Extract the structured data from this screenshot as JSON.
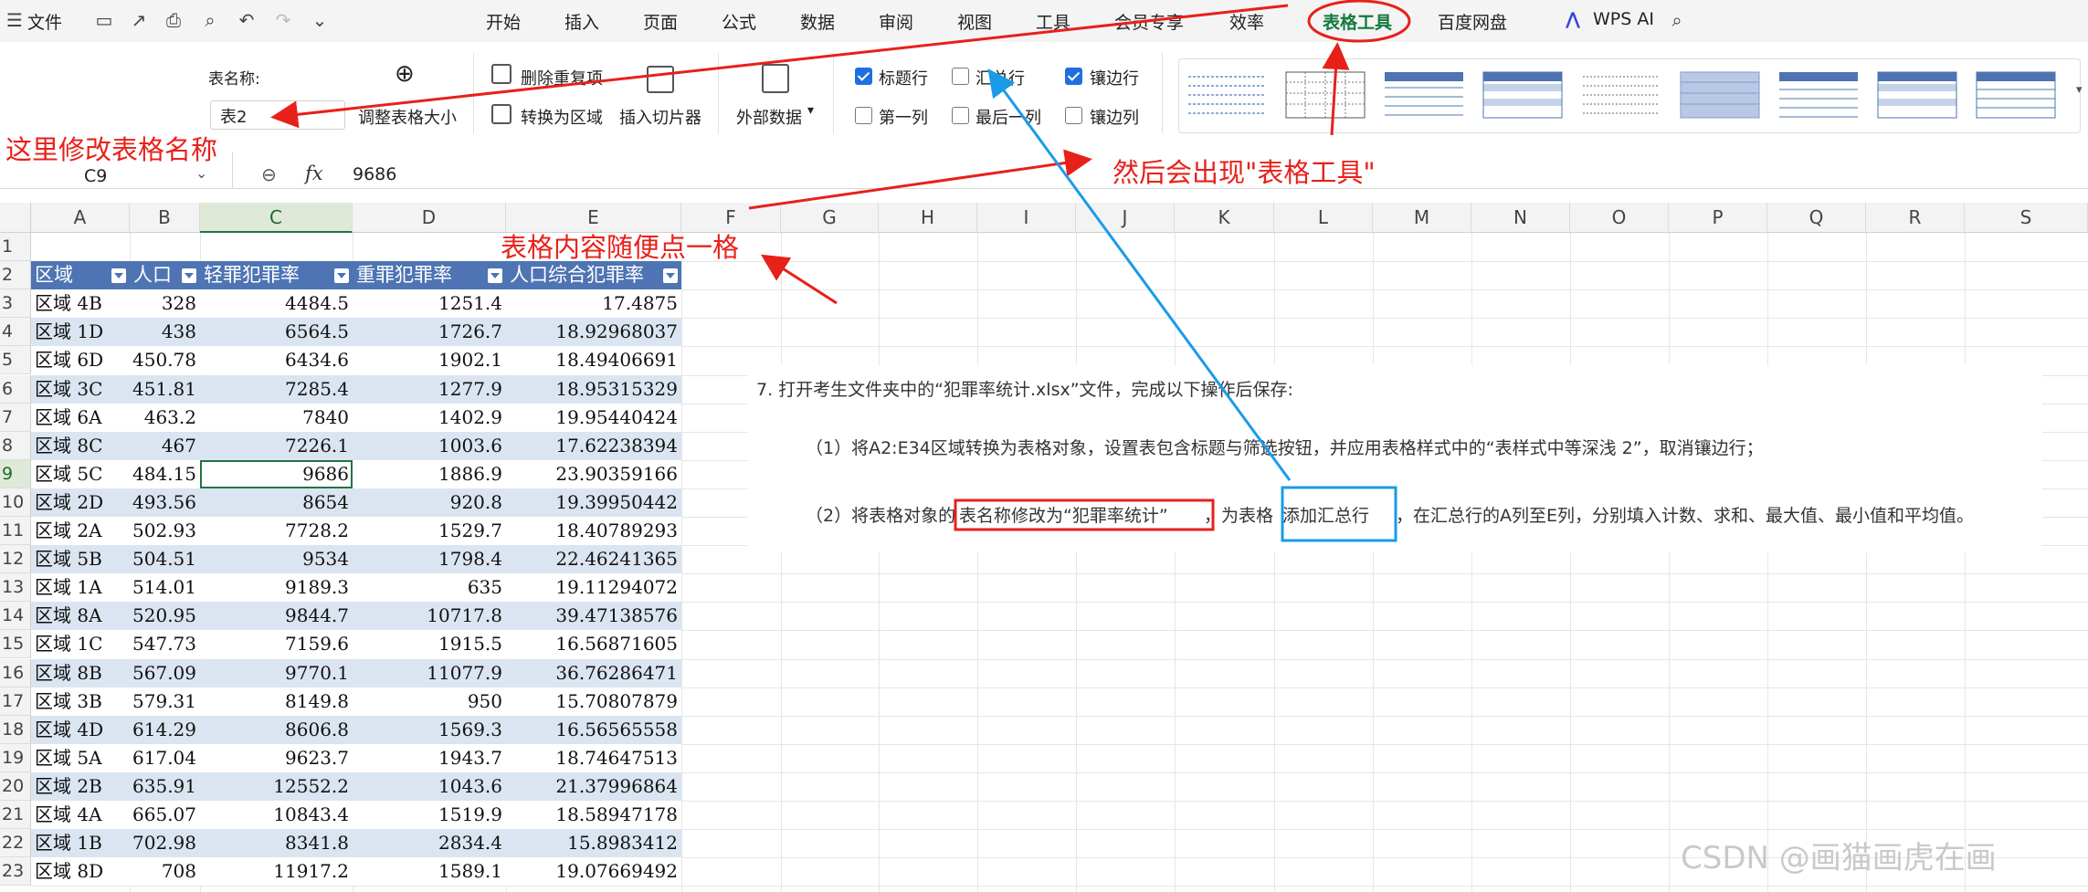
{
  "menubar": {
    "file_label": "文件",
    "tabs": [
      {
        "label": "开始"
      },
      {
        "label": "插入"
      },
      {
        "label": "页面"
      },
      {
        "label": "公式"
      },
      {
        "label": "数据"
      },
      {
        "label": "审阅"
      },
      {
        "label": "视图"
      },
      {
        "label": "工具"
      },
      {
        "label": "会员专享"
      },
      {
        "label": "效率"
      }
    ],
    "active_tab": "表格工具",
    "cloud_tab": "百度网盘",
    "wps_ai": "WPS AI"
  },
  "ribbon": {
    "table_name_label": "表名称:",
    "table_name_value": "表2",
    "resize_label": "调整表格大小",
    "remove_dup_label": "删除重复项",
    "convert_label": "转换为区域",
    "slicer_label": "插入切片器",
    "external_label": "外部数据",
    "checkboxes": {
      "header_row": {
        "label": "标题行",
        "checked": true
      },
      "total_row": {
        "label": "汇总行",
        "checked": false
      },
      "banded_rows": {
        "label": "镶边行",
        "checked": true
      },
      "first_col": {
        "label": "第一列",
        "checked": false
      },
      "last_col": {
        "label": "最后一列",
        "checked": false
      },
      "banded_cols": {
        "label": "镶边列",
        "checked": false
      }
    }
  },
  "formula_bar": {
    "name_box": "C9",
    "fx": "fx",
    "value": "9686"
  },
  "columns": [
    "A",
    "B",
    "C",
    "D",
    "E",
    "F",
    "G",
    "H",
    "I",
    "J",
    "K",
    "L",
    "M",
    "N",
    "O",
    "P",
    "Q",
    "R",
    "S"
  ],
  "rows": [
    "1",
    "2",
    "3",
    "4",
    "5",
    "6",
    "7",
    "8",
    "9",
    "10",
    "11",
    "12",
    "13",
    "14",
    "15",
    "16",
    "17",
    "18",
    "19",
    "20",
    "21",
    "22",
    "23"
  ],
  "table": {
    "headers": [
      "区域",
      "人口",
      "轻罪犯罪率",
      "重罪犯罪率",
      "人口综合犯罪率"
    ],
    "data": [
      [
        "区域 4B",
        "328",
        "4484.5",
        "1251.4",
        "17.4875"
      ],
      [
        "区域 1D",
        "438",
        "6564.5",
        "1726.7",
        "18.92968037"
      ],
      [
        "区域 6D",
        "450.78",
        "6434.6",
        "1902.1",
        "18.49406691"
      ],
      [
        "区域 3C",
        "451.81",
        "7285.4",
        "1277.9",
        "18.95315329"
      ],
      [
        "区域 6A",
        "463.2",
        "7840",
        "1402.9",
        "19.95440424"
      ],
      [
        "区域 8C",
        "467",
        "7226.1",
        "1003.6",
        "17.62238394"
      ],
      [
        "区域 5C",
        "484.15",
        "9686",
        "1886.9",
        "23.90359166"
      ],
      [
        "区域 2D",
        "493.56",
        "8654",
        "920.8",
        "19.39950442"
      ],
      [
        "区域 2A",
        "502.93",
        "7728.2",
        "1529.7",
        "18.40789293"
      ],
      [
        "区域 5B",
        "504.51",
        "9534",
        "1798.4",
        "22.46241365"
      ],
      [
        "区域 1A",
        "514.01",
        "9189.3",
        "635",
        "19.11294072"
      ],
      [
        "区域 8A",
        "520.95",
        "9844.7",
        "10717.8",
        "39.47138576"
      ],
      [
        "区域 1C",
        "547.73",
        "7159.6",
        "1915.5",
        "16.56871605"
      ],
      [
        "区域 8B",
        "567.09",
        "9770.1",
        "11077.9",
        "36.76286471"
      ],
      [
        "区域 3B",
        "579.31",
        "8149.8",
        "950",
        "15.70807879"
      ],
      [
        "区域 4D",
        "614.29",
        "8606.8",
        "1569.3",
        "16.56565558"
      ],
      [
        "区域 5A",
        "617.04",
        "9623.7",
        "1943.7",
        "18.74647513"
      ],
      [
        "区域 2B",
        "635.91",
        "12552.2",
        "1043.6",
        "21.37996864"
      ],
      [
        "区域 4A",
        "665.07",
        "10843.4",
        "1519.9",
        "18.58947178"
      ],
      [
        "区域 1B",
        "702.98",
        "8341.8",
        "2834.4",
        "15.8983412"
      ],
      [
        "区域 8D",
        "708",
        "11917.2",
        "1589.1",
        "19.07669492"
      ]
    ]
  },
  "instructions": {
    "line1": "7. 打开考生文件夹中的“犯罪率统计.xlsx”文件，完成以下操作后保存:",
    "line2": "（1）将A2:E34区域转换为表格对象，设置表包含标题与筛选按钮，并应用表格样式中的“表样式中等深浅 2”，取消镶边行；",
    "line3_pre": "（2）将表格对象的",
    "line3_box1": "表名称修改为“犯罪率统计”",
    "line3_mid": "，为表格",
    "line3_box2": "添加汇总行",
    "line3_post": "，在汇总行的A列至E列，分别填入计数、求和、最大值、最小值和平均值。"
  },
  "annotations": {
    "rename": "这里修改表格名称",
    "toolbar_appears": "然后会出现\"表格工具\"",
    "click_cell": "表格内容随便点一格"
  },
  "watermark": "CSDN @画猫画虎在画",
  "colors": {
    "table_header": "#4e74b3",
    "band": "#dbe5f1",
    "annotation_red": "#e8201a",
    "annotation_blue": "#1a9be8",
    "active_tab": "#127a3c"
  }
}
